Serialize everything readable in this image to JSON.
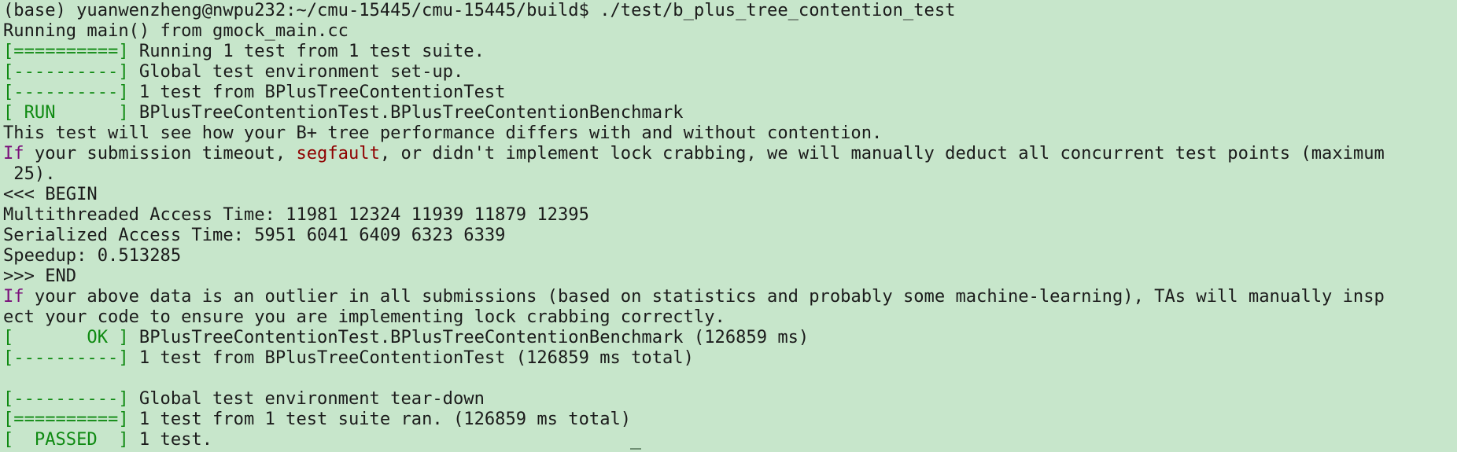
{
  "terminal": {
    "lines": [
      {
        "segments": [
          {
            "text": "(base) yuanwenzheng@nwpu232:~/cmu-15445/cmu-15445/build$ ./test/b_plus_tree_contention_test",
            "color": "default"
          }
        ]
      },
      {
        "segments": [
          {
            "text": "Running main() from gmock_main.cc",
            "color": "default"
          }
        ]
      },
      {
        "segments": [
          {
            "text": "[==========]",
            "color": "green"
          },
          {
            "text": " Running 1 test from 1 test suite.",
            "color": "default"
          }
        ]
      },
      {
        "segments": [
          {
            "text": "[----------]",
            "color": "green"
          },
          {
            "text": " Global test environment set-up.",
            "color": "default"
          }
        ]
      },
      {
        "segments": [
          {
            "text": "[----------]",
            "color": "green"
          },
          {
            "text": " 1 test from BPlusTreeContentionTest",
            "color": "default"
          }
        ]
      },
      {
        "segments": [
          {
            "text": "[ RUN      ]",
            "color": "green"
          },
          {
            "text": " BPlusTreeContentionTest.BPlusTreeContentionBenchmark",
            "color": "default"
          }
        ]
      },
      {
        "segments": [
          {
            "text": "This test will see how your B+ tree performance differs with and without contention.",
            "color": "default"
          }
        ]
      },
      {
        "segments": [
          {
            "text": "If",
            "color": "purple"
          },
          {
            "text": " your submission timeout, ",
            "color": "default"
          },
          {
            "text": "segfault",
            "color": "red"
          },
          {
            "text": ", or didn't implement lock crabbing, we will manually deduct all concurrent test points (maximum",
            "color": "default"
          }
        ]
      },
      {
        "segments": [
          {
            "text": " 25).",
            "color": "default"
          }
        ]
      },
      {
        "segments": [
          {
            "text": "<<< BEGIN",
            "color": "default"
          }
        ]
      },
      {
        "segments": [
          {
            "text": "Multithreaded Access Time: 11981 12324 11939 11879 12395",
            "color": "default"
          }
        ]
      },
      {
        "segments": [
          {
            "text": "Serialized Access Time: 5951 6041 6409 6323 6339",
            "color": "default"
          }
        ]
      },
      {
        "segments": [
          {
            "text": "Speedup: 0.513285",
            "color": "default"
          }
        ]
      },
      {
        "segments": [
          {
            "text": ">>> END",
            "color": "default"
          }
        ]
      },
      {
        "segments": [
          {
            "text": "If",
            "color": "purple"
          },
          {
            "text": " your above data is an outlier in all submissions (based on statistics and probably some machine-learning), TAs will manually insp",
            "color": "default"
          }
        ]
      },
      {
        "segments": [
          {
            "text": "ect your code to ensure you are implementing lock crabbing correctly.",
            "color": "default"
          }
        ]
      },
      {
        "segments": [
          {
            "text": "[       OK ]",
            "color": "green"
          },
          {
            "text": " BPlusTreeContentionTest.BPlusTreeContentionBenchmark (126859 ms)",
            "color": "default"
          }
        ]
      },
      {
        "segments": [
          {
            "text": "[----------]",
            "color": "green"
          },
          {
            "text": " 1 test from BPlusTreeContentionTest (126859 ms total)",
            "color": "default"
          }
        ]
      },
      {
        "segments": [
          {
            "text": "",
            "color": "default"
          }
        ]
      },
      {
        "segments": [
          {
            "text": "[----------]",
            "color": "green"
          },
          {
            "text": " Global test environment tear-down",
            "color": "default"
          }
        ]
      },
      {
        "segments": [
          {
            "text": "[==========]",
            "color": "green"
          },
          {
            "text": " 1 test from 1 test suite ran. (126859 ms total)",
            "color": "default"
          }
        ]
      },
      {
        "segments": [
          {
            "text": "[  PASSED  ]",
            "color": "green"
          },
          {
            "text": " 1 test.",
            "color": "default"
          }
        ]
      }
    ]
  },
  "colors": {
    "background": "#c7e6cb",
    "default": "#1b1b1b",
    "green": "#0f8a12",
    "purple": "#7a0f7a",
    "red": "#8f0000"
  }
}
